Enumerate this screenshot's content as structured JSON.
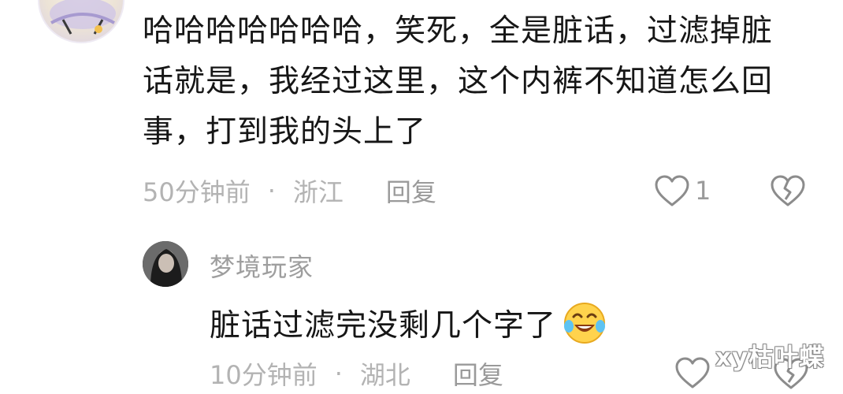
{
  "comment": {
    "text": "哈哈哈哈哈哈哈，笑死，全是脏话，过滤掉脏话就是，我经过这里，这个内裤不知道怎么回事，打到我的头上了",
    "time": "50分钟前",
    "separator": "·",
    "location": "浙江",
    "reply_label": "回复",
    "like_count": "1",
    "avatar_icon": "user-avatar",
    "like_icon": "heart-outline-icon",
    "dislike_icon": "broken-heart-icon"
  },
  "reply": {
    "username": "梦境玩家",
    "text": "脏话过滤完没剩几个字了",
    "emoji_icon": "crying-laughing-emoji-icon",
    "time": "10分钟前",
    "separator": "·",
    "location": "湖北",
    "reply_label": "回复",
    "avatar_icon": "user-avatar",
    "like_icon": "heart-outline-icon",
    "dislike_icon": "broken-heart-icon"
  },
  "watermark": "xy枯叶蝶",
  "colors": {
    "text": "#161616",
    "meta": "#b3b3b3",
    "icon_stroke": "#8c8c8c",
    "emoji_face": "#ffd34d"
  }
}
